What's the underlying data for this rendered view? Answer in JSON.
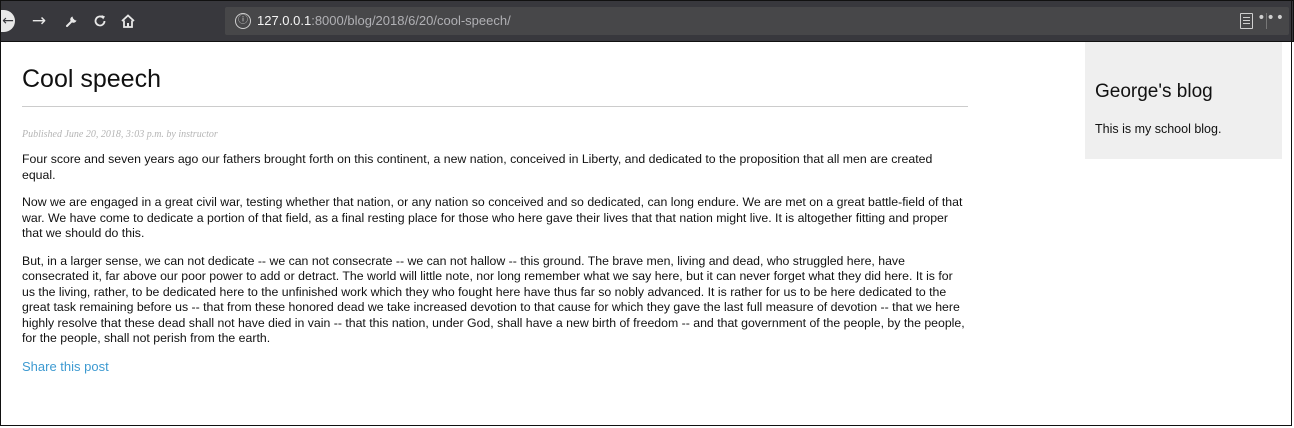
{
  "browser": {
    "back_icon": "arrow-left",
    "forward_icon": "arrow-right",
    "tools_icon": "wrench",
    "reload_icon": "reload",
    "home_icon": "home",
    "url_host": "127.0.0.1",
    "url_rest": ":8000/blog/2018/6/20/cool-speech/",
    "info_icon": "ⓘ",
    "more_icon": "•••"
  },
  "post": {
    "title": "Cool speech",
    "meta": "Published June 20, 2018, 3:03 p.m. by instructor",
    "paragraphs": [
      "Four score and seven years ago our fathers brought forth on this continent, a new nation, conceived in Liberty, and dedicated to the proposition that all men are created equal.",
      "Now we are engaged in a great civil war, testing whether that nation, or any nation so conceived and so dedicated, can long endure. We are met on a great battle-field of that war. We have come to dedicate a portion of that field, as a final resting place for those who here gave their lives that that nation might live. It is altogether fitting and proper that we should do this.",
      "But, in a larger sense, we can not dedicate -- we can not consecrate -- we can not hallow -- this ground. The brave men, living and dead, who struggled here, have consecrated it, far above our poor power to add or detract. The world will little note, nor long remember what we say here, but it can never forget what they did here. It is for us the living, rather, to be dedicated here to the unfinished work which they who fought here have thus far so nobly advanced. It is rather for us to be here dedicated to the great task remaining before us -- that from these honored dead we take increased devotion to that cause for which they gave the last full measure of devotion -- that we here highly resolve that these dead shall not have died in vain -- that this nation, under God, shall have a new birth of freedom -- and that government of the people, by the people, for the people, shall not perish from the earth."
    ],
    "share_label": "Share this post"
  },
  "sidebar": {
    "title": "George's blog",
    "description": "This is my school blog."
  }
}
